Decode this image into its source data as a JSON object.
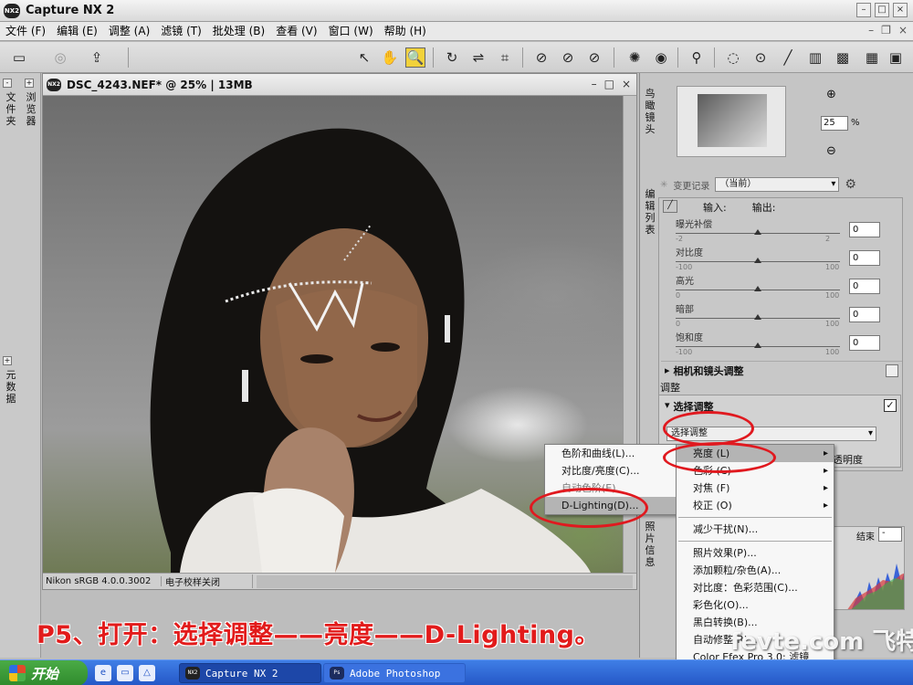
{
  "app": {
    "title": "Capture NX 2",
    "logo": "NX2"
  },
  "menubar": [
    "文件 (F)",
    "编辑 (E)",
    "调整 (A)",
    "滤镜 (T)",
    "批处理 (B)",
    "查看 (V)",
    "窗口 (W)",
    "帮助 (H)"
  ],
  "left_tabs": {
    "folders": "文件夹",
    "browser": "浏览器",
    "metadata": "元数据"
  },
  "document": {
    "title": "DSC_4243.NEF* @ 25% | 13MB",
    "profile": "Nikon sRGB 4.0.0.3002",
    "softproof": "电子校样关闭"
  },
  "right_panel": {
    "birdseye_label": "鸟瞰镜头",
    "zoom_value": "25",
    "zoom_unit": "%",
    "edit_list_label": "编辑列表",
    "history_label": "变更记录",
    "history_value": "（当前）",
    "input_label": "输入:",
    "output_label": "输出:",
    "sliders": [
      {
        "label": "曝光补偿",
        "min": "-2",
        "max": "2",
        "value": "0",
        "pos": 0.5
      },
      {
        "label": "对比度",
        "min": "-100",
        "max": "100",
        "value": "0",
        "pos": 0.5
      },
      {
        "label": "高光",
        "min": "0",
        "max": "100",
        "value": "0",
        "pos": 0.5
      },
      {
        "label": "暗部",
        "min": "0",
        "max": "100",
        "value": "0",
        "pos": 0.5
      },
      {
        "label": "饱和度",
        "min": "-100",
        "max": "100",
        "value": "0",
        "pos": 0.5
      }
    ],
    "camera_lens_section": "相机和镜头调整",
    "adjust_label": "调整",
    "select_adjust_header": "选择调整",
    "select_adjust_field": "选择调整",
    "opacity_label": "透明度",
    "photo_info_label": "照片信息",
    "histogram_end_label": "结束",
    "histogram_end_value": "-"
  },
  "submenu_left": {
    "items": [
      "色阶和曲线(L)...",
      "对比度/亮度(C)...",
      "自动色阶(E)",
      "D-Lighting(D)..."
    ]
  },
  "submenu_right": {
    "items": [
      "亮度 (L)",
      "色彩 (C)",
      "对焦 (F)",
      "校正 (O)",
      "减少干扰(N)...",
      "照片效果(P)...",
      "添加颗粒/杂色(A)...",
      "对比度：色彩范围(C)...",
      "彩色化(O)...",
      "黑白转换(B)...",
      "自动修整(R)...",
      "Color Efex Pro 3.0: 滤镜"
    ]
  },
  "caption": "P5、打开：选择调整——亮度——D-Lighting。",
  "watermark": "fevte.com 飞特教程网",
  "taskbar": {
    "start": "开始",
    "tasks": [
      "Capture NX 2",
      "Adobe Photoshop"
    ]
  },
  "colors": {
    "annotation_red": "#e0191f",
    "taskbar_blue": "#2558c7",
    "start_green": "#3a9c37"
  }
}
